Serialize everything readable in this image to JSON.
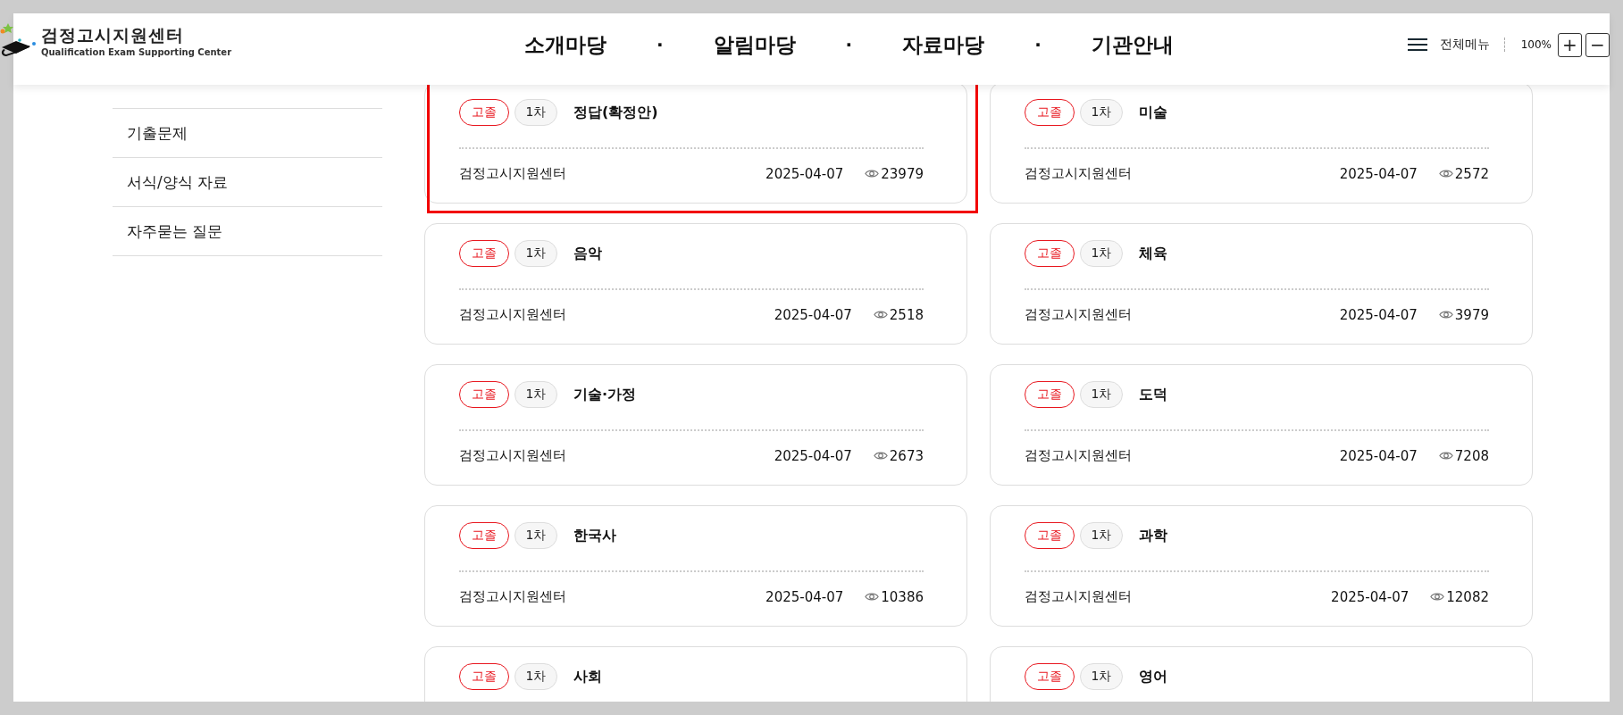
{
  "header": {
    "logo": {
      "title": "검정고시지원센터",
      "subtitle": "Qualification Exam Supporting Center"
    },
    "nav": [
      "소개마당",
      "·",
      "알림마당",
      "·",
      "자료마당",
      "·",
      "기관안내"
    ],
    "menu_label": "전체메뉴",
    "zoom": "100%",
    "zoom_in": "+",
    "zoom_out": "−"
  },
  "sidebar": {
    "items": [
      "기출문제",
      "서식/양식 자료",
      "자주묻는 질문"
    ]
  },
  "posts": [
    {
      "level": "고졸",
      "round": "1차",
      "title": "정답(확정안)",
      "author": "검정고시지원센터",
      "date": "2025-04-07",
      "views": "23979",
      "highlighted": true
    },
    {
      "level": "고졸",
      "round": "1차",
      "title": "미술",
      "author": "검정고시지원센터",
      "date": "2025-04-07",
      "views": "2572",
      "highlighted": false
    },
    {
      "level": "고졸",
      "round": "1차",
      "title": "음악",
      "author": "검정고시지원센터",
      "date": "2025-04-07",
      "views": "2518",
      "highlighted": false
    },
    {
      "level": "고졸",
      "round": "1차",
      "title": "체육",
      "author": "검정고시지원센터",
      "date": "2025-04-07",
      "views": "3979",
      "highlighted": false
    },
    {
      "level": "고졸",
      "round": "1차",
      "title": "기술·가정",
      "author": "검정고시지원센터",
      "date": "2025-04-07",
      "views": "2673",
      "highlighted": false
    },
    {
      "level": "고졸",
      "round": "1차",
      "title": "도덕",
      "author": "검정고시지원센터",
      "date": "2025-04-07",
      "views": "7208",
      "highlighted": false
    },
    {
      "level": "고졸",
      "round": "1차",
      "title": "한국사",
      "author": "검정고시지원센터",
      "date": "2025-04-07",
      "views": "10386",
      "highlighted": false
    },
    {
      "level": "고졸",
      "round": "1차",
      "title": "과학",
      "author": "검정고시지원센터",
      "date": "2025-04-07",
      "views": "12082",
      "highlighted": false
    },
    {
      "level": "고졸",
      "round": "1차",
      "title": "사회",
      "highlighted": false
    },
    {
      "level": "고졸",
      "round": "1차",
      "title": "영어",
      "highlighted": false
    }
  ]
}
